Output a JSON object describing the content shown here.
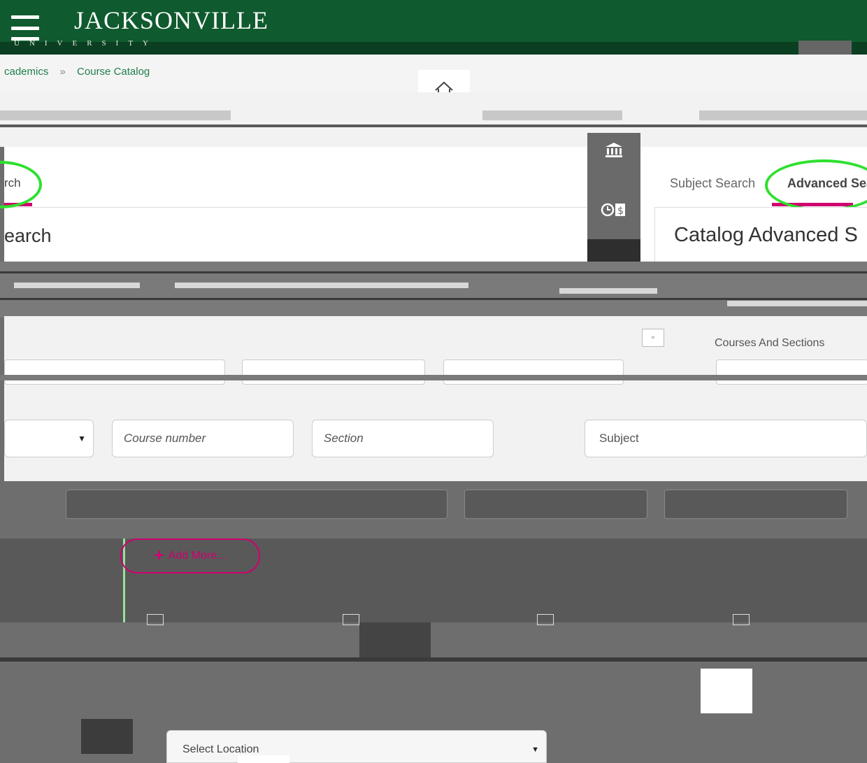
{
  "header": {
    "logo": "JACKSONVILLE",
    "logo_sub": "UNIVERSITY",
    "menu_icon": "hamburger-menu-icon"
  },
  "breadcrumb": {
    "items": [
      "cademics",
      "Course Catalog"
    ],
    "separator": "»",
    "home_icon": "home-icon"
  },
  "left_panel": {
    "tab_label": "rch",
    "heading": "earch"
  },
  "rail": {
    "icons": [
      "bank-icon",
      "clock-dollar-icon",
      "graduation-cap-icon"
    ]
  },
  "right_panel": {
    "tab_subject": "Subject Search",
    "tab_advanced": "Advanced Sea",
    "heading": "Catalog Advanced S"
  },
  "form": {
    "courses_sections_label": "Courses And Sections",
    "subject_dropdown_caret": "▼",
    "course_number_placeholder": "Course number",
    "section_placeholder": "Section",
    "subject_placeholder": "Subject"
  },
  "lower": {
    "add_more_label": "Add More...",
    "add_more_plus": "+",
    "select_location": "Select Location",
    "location_caret": "▼"
  },
  "colors": {
    "brand_green": "#0f5a2e",
    "accent_magenta": "#d0006f",
    "highlight_green": "#2ee02e",
    "overlay_gray": "#6e6e6e"
  }
}
